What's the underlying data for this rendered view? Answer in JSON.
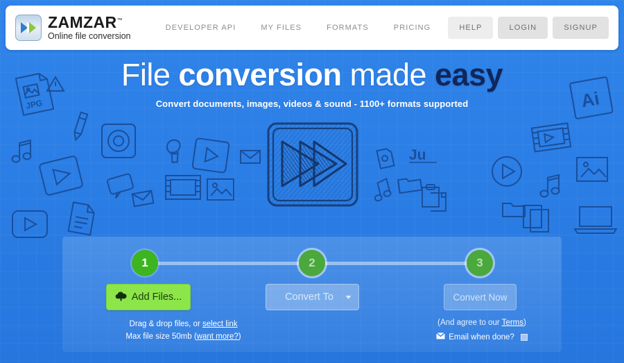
{
  "brand": {
    "name": "ZAMZAR",
    "trademark": "™",
    "tagline": "Online file conversion",
    "logo_icon": "double-chevron-icon",
    "logo_blue": "#2f7fd0",
    "logo_green": "#8cc63f"
  },
  "nav": {
    "links": [
      {
        "label": "DEVELOPER API",
        "name": "nav-developer-api"
      },
      {
        "label": "MY FILES",
        "name": "nav-my-files"
      },
      {
        "label": "FORMATS",
        "name": "nav-formats"
      },
      {
        "label": "PRICING",
        "name": "nav-pricing"
      }
    ],
    "buttons": [
      {
        "label": "HELP",
        "name": "nav-help",
        "style": "light"
      },
      {
        "label": "LOGIN",
        "name": "nav-login",
        "style": "dark"
      },
      {
        "label": "SIGNUP",
        "name": "nav-signup",
        "style": "dark"
      }
    ]
  },
  "hero": {
    "headline_part1": "File ",
    "headline_part2": "conversion",
    "headline_part3": " made ",
    "headline_part4": "easy",
    "subheadline": "Convert documents, images, videos & sound - 1100+ formats supported",
    "center_icon": "fast-forward-sketch-icon"
  },
  "wizard": {
    "steps": [
      {
        "number": "1",
        "state": "active"
      },
      {
        "number": "2",
        "state": "idle"
      },
      {
        "number": "3",
        "state": "idle"
      }
    ],
    "add_files_label": "Add Files...",
    "add_files_icon": "upload-arrow-icon",
    "convert_to_label": "Convert To",
    "convert_to_icon": "chevron-down-icon",
    "convert_now_label": "Convert Now",
    "hint_line1_prefix": "Drag & drop files, or ",
    "hint_line1_link": "select link",
    "hint_line2_prefix": "Max file size 50mb (",
    "hint_line2_link": "want more?",
    "hint_line2_suffix": ")",
    "terms_prefix": "(And agree to our ",
    "terms_link": "Terms",
    "terms_suffix": ")",
    "email_icon": "envelope-icon",
    "email_label": "Email when done?"
  },
  "colors": {
    "background_blue": "#2a7de4",
    "step_active_green": "#3cb521",
    "add_files_green": "#8ce64a",
    "headline_dark": "#10275c"
  }
}
